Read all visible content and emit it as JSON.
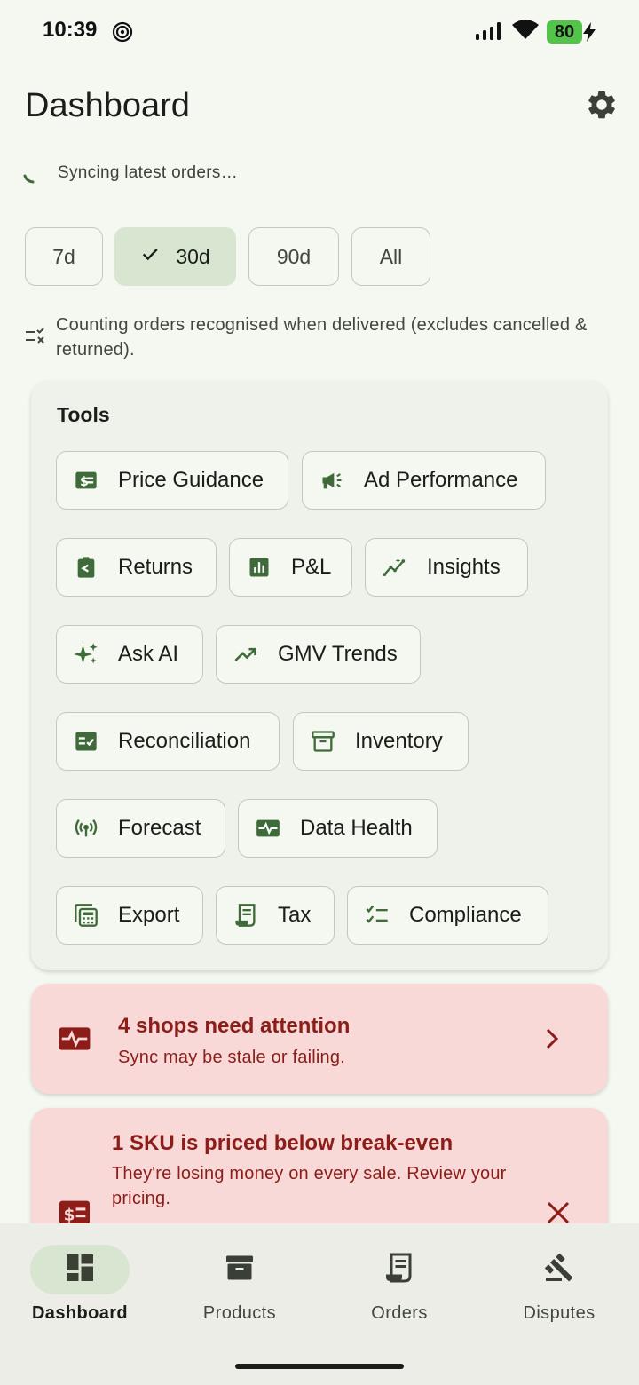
{
  "status_bar": {
    "time": "10:39",
    "battery": "80"
  },
  "header": {
    "title": "Dashboard",
    "settings_icon": "gear-icon"
  },
  "sync": {
    "text": "Syncing latest orders…"
  },
  "periods": [
    {
      "label": "7d",
      "selected": false
    },
    {
      "label": "30d",
      "selected": true
    },
    {
      "label": "90d",
      "selected": false
    },
    {
      "label": "All",
      "selected": false
    }
  ],
  "note": {
    "text": "Counting orders recognised when delivered (excludes cancelled & returned)."
  },
  "tools": {
    "title": "Tools",
    "items": [
      {
        "label": "Price Guidance",
        "icon": "price-tag-icon"
      },
      {
        "label": "Ad Performance",
        "icon": "megaphone-icon"
      },
      {
        "label": "Returns",
        "icon": "return-icon"
      },
      {
        "label": "P&L",
        "icon": "bar-chart-icon"
      },
      {
        "label": "Insights",
        "icon": "insights-icon"
      },
      {
        "label": "Ask AI",
        "icon": "sparkle-icon"
      },
      {
        "label": "GMV Trends",
        "icon": "trending-up-icon"
      },
      {
        "label": "Reconciliation",
        "icon": "checklist-icon"
      },
      {
        "label": "Inventory",
        "icon": "archive-icon"
      },
      {
        "label": "Forecast",
        "icon": "broadcast-icon"
      },
      {
        "label": "Data Health",
        "icon": "monitor-heart-icon"
      },
      {
        "label": "Export",
        "icon": "calculator-icon"
      },
      {
        "label": "Tax",
        "icon": "receipt-icon"
      },
      {
        "label": "Compliance",
        "icon": "checklist-rtl-icon"
      }
    ]
  },
  "alerts": [
    {
      "title": "4 shops need attention",
      "body": "Sync may be stale or failing.",
      "icon": "monitor-heart-icon",
      "action_icon": "chevron-right-icon"
    },
    {
      "title": "1 SKU is priced below break-even",
      "body": "They're losing money on every sale. Review your pricing.",
      "icon": "price-tag-icon",
      "action_icon": "close-icon"
    }
  ],
  "bottom_nav": [
    {
      "label": "Dashboard",
      "icon": "dashboard-icon",
      "active": true
    },
    {
      "label": "Products",
      "icon": "archive-icon",
      "active": false
    },
    {
      "label": "Orders",
      "icon": "receipt-icon",
      "active": false
    },
    {
      "label": "Disputes",
      "icon": "gavel-icon",
      "active": false
    }
  ],
  "colors": {
    "accent": "#3f6b3a",
    "selected_chip": "#d7e5d1",
    "alert_bg": "#f8d9d7",
    "alert_text": "#8c1d18"
  }
}
